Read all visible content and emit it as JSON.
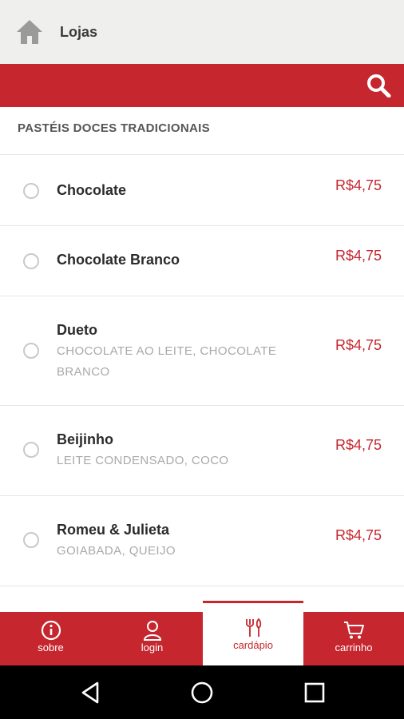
{
  "header": {
    "title": "Lojas",
    "home_icon": "home-icon"
  },
  "search": {
    "icon": "search-icon"
  },
  "section": {
    "title": "PASTÉIS DOCES TRADICIONAIS"
  },
  "items": [
    {
      "name": "Chocolate",
      "desc": "",
      "price": "R$4,75"
    },
    {
      "name": "Chocolate Branco",
      "desc": "",
      "price": "R$4,75"
    },
    {
      "name": "Dueto",
      "desc": "CHOCOLATE AO LEITE, CHOCOLATE BRANCO",
      "price": "R$4,75"
    },
    {
      "name": "Beijinho",
      "desc": "LEITE CONDENSADO, COCO",
      "price": "R$4,75"
    },
    {
      "name": "Romeu & Julieta",
      "desc": "GOIABADA, QUEIJO",
      "price": "R$4,75"
    }
  ],
  "tabs": [
    {
      "label": "sobre",
      "icon": "info-icon"
    },
    {
      "label": "login",
      "icon": "user-icon"
    },
    {
      "label": "cardápio",
      "icon": "cutlery-icon",
      "active": true
    },
    {
      "label": "carrinho",
      "icon": "cart-icon"
    }
  ],
  "colors": {
    "brand_red": "#c6262e",
    "topbar_bg": "#efefed"
  }
}
